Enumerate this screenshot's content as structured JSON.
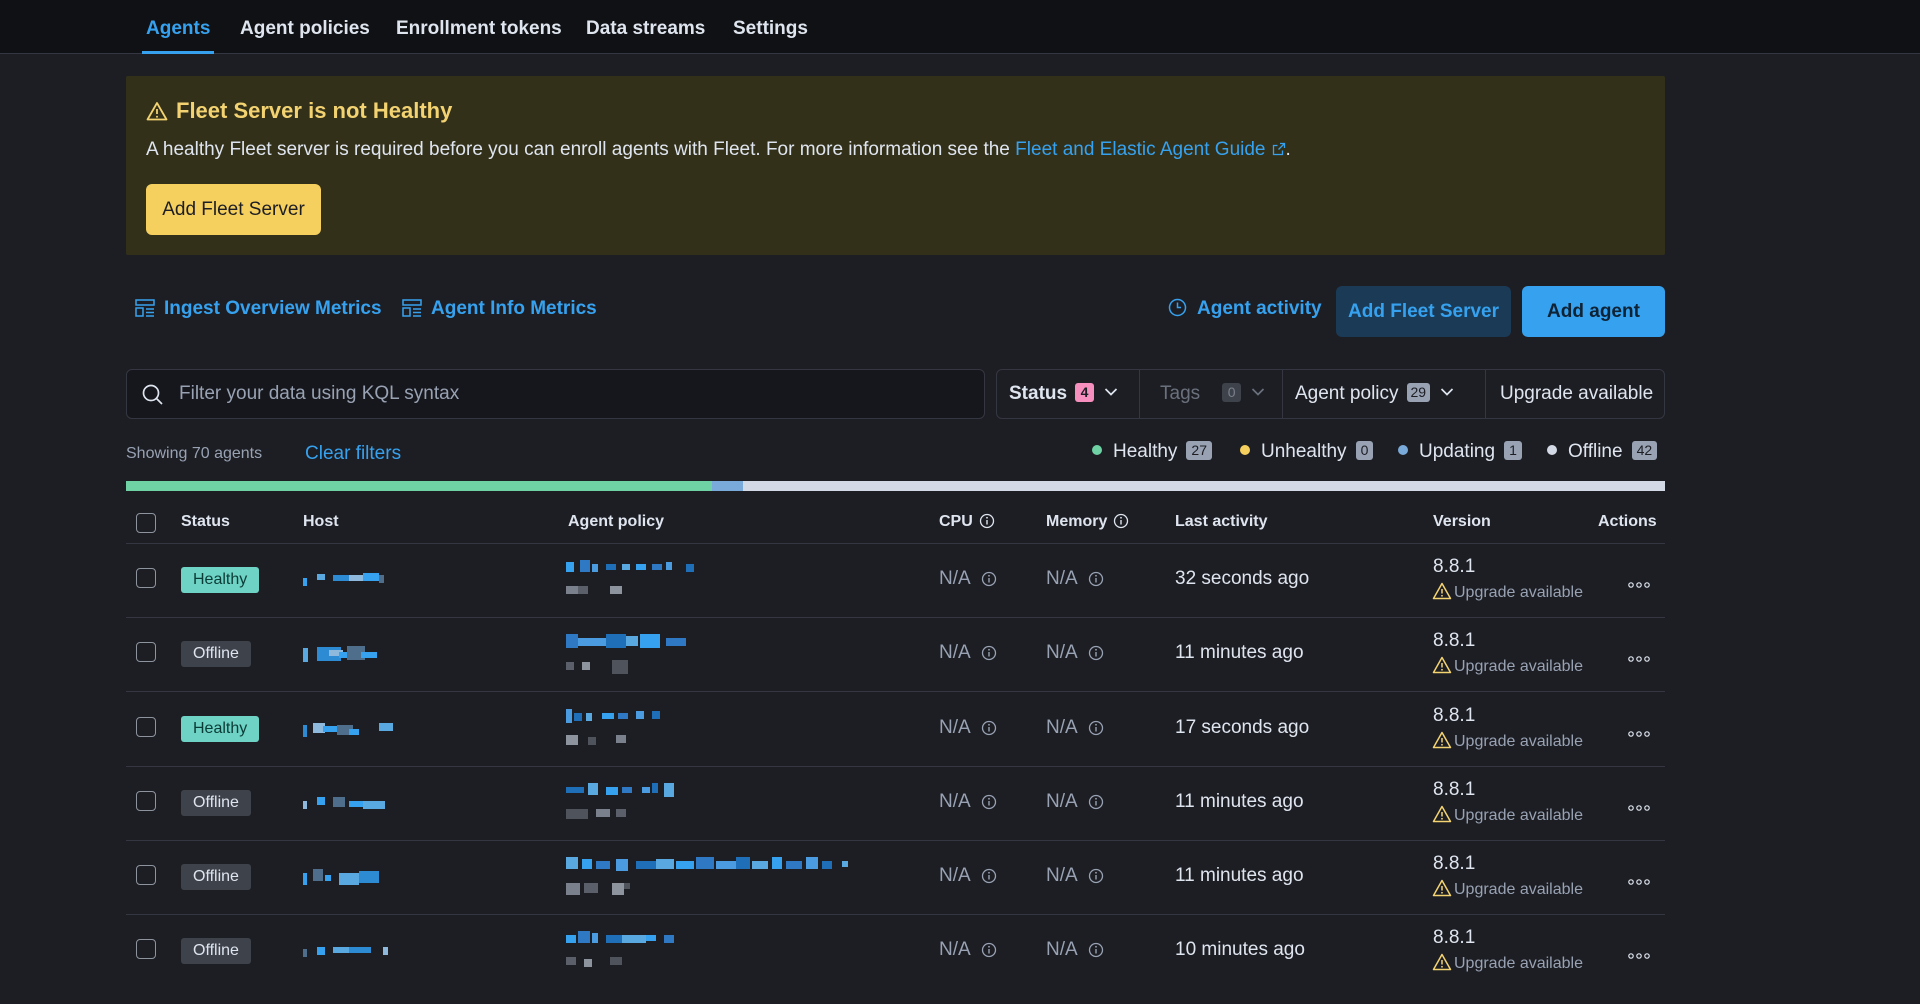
{
  "tabs": [
    "Agents",
    "Agent policies",
    "Enrollment tokens",
    "Data streams",
    "Settings"
  ],
  "callout": {
    "title": "Fleet Server is not Healthy",
    "text": "A healthy Fleet server is required before you can enroll agents with Fleet. For more information see the ",
    "link": "Fleet and Elastic Agent Guide",
    "text_end": ".",
    "button": "Add Fleet Server"
  },
  "actions": {
    "ingest_metrics": "Ingest Overview Metrics",
    "agent_info_metrics": "Agent Info Metrics",
    "agent_activity": "Agent activity",
    "add_fleet_server": "Add Fleet Server",
    "add_agent": "Add agent"
  },
  "search": {
    "placeholder": "Filter your data using KQL syntax"
  },
  "filters": {
    "status": {
      "label": "Status",
      "count": "4"
    },
    "tags": {
      "label": "Tags",
      "count": "0"
    },
    "agent_policy": {
      "label": "Agent policy",
      "count": "29"
    },
    "upgrade": {
      "label": "Upgrade available"
    }
  },
  "summary": {
    "showing": "Showing 70 agents",
    "clear": "Clear filters",
    "legend": [
      {
        "label": "Healthy",
        "count": "27",
        "color": "#6ed2a4"
      },
      {
        "label": "Unhealthy",
        "count": "0",
        "color": "#f6d05e"
      },
      {
        "label": "Updating",
        "count": "1",
        "color": "#79aad9"
      },
      {
        "label": "Offline",
        "count": "42",
        "color": "#d4dae5"
      }
    ]
  },
  "table": {
    "headers": {
      "status": "Status",
      "host": "Host",
      "policy": "Agent policy",
      "cpu": "CPU",
      "memory": "Memory",
      "last": "Last activity",
      "version": "Version",
      "actions": "Actions"
    },
    "rows": [
      {
        "status": "Healthy",
        "cpu": "N/A",
        "memory": "N/A",
        "last": "32 seconds ago",
        "version": "8.8.1",
        "upgrade": "Upgrade available"
      },
      {
        "status": "Offline",
        "cpu": "N/A",
        "memory": "N/A",
        "last": "11 minutes ago",
        "version": "8.8.1",
        "upgrade": "Upgrade available"
      },
      {
        "status": "Healthy",
        "cpu": "N/A",
        "memory": "N/A",
        "last": "17 seconds ago",
        "version": "8.8.1",
        "upgrade": "Upgrade available"
      },
      {
        "status": "Offline",
        "cpu": "N/A",
        "memory": "N/A",
        "last": "11 minutes ago",
        "version": "8.8.1",
        "upgrade": "Upgrade available"
      },
      {
        "status": "Offline",
        "cpu": "N/A",
        "memory": "N/A",
        "last": "11 minutes ago",
        "version": "8.8.1",
        "upgrade": "Upgrade available"
      },
      {
        "status": "Offline",
        "cpu": "N/A",
        "memory": "N/A",
        "last": "10 minutes ago",
        "version": "8.8.1",
        "upgrade": "Upgrade available"
      }
    ]
  }
}
